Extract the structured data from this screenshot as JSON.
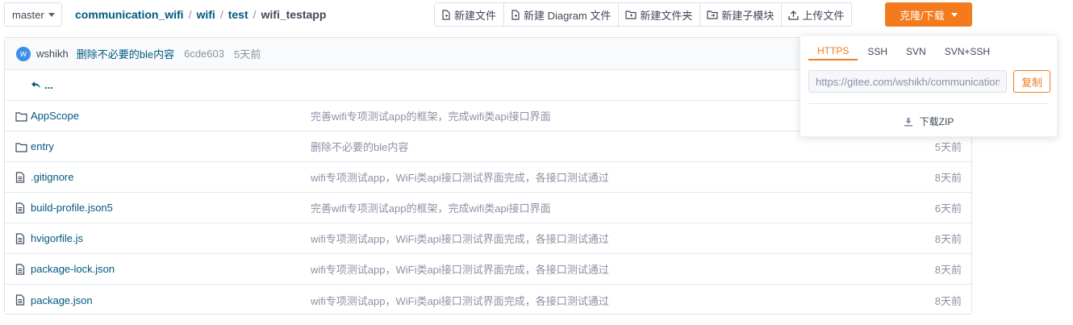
{
  "branch": {
    "label": "master"
  },
  "breadcrumb": {
    "repo": "communication_wifi",
    "dir1": "wifi",
    "dir2": "test",
    "current": "wifi_testapp",
    "sep": "/"
  },
  "toolbar": {
    "new_file": "新建文件",
    "new_diagram": "新建 Diagram 文件",
    "new_folder": "新建文件夹",
    "new_submodule": "新建子模块",
    "upload": "上传文件",
    "clone": "克隆/下载"
  },
  "commit": {
    "avatar_letter": "w",
    "author": "wshikh",
    "message": "删除不必要的ble内容",
    "sha": "6cde603",
    "time": "5天前"
  },
  "back": {
    "label": "..."
  },
  "files": [
    {
      "type": "folder",
      "name": "AppScope",
      "message": "完善wifi专项测试app的框架，完成wifi类api接口界面",
      "time": ""
    },
    {
      "type": "folder",
      "name": "entry",
      "message": "删除不必要的ble内容",
      "time": "5天前"
    },
    {
      "type": "file",
      "name": ".gitignore",
      "message": "wifi专项测试app，WiFi类api接口测试界面完成，各接口测试通过",
      "time": "8天前"
    },
    {
      "type": "file",
      "name": "build-profile.json5",
      "message": "完善wifi专项测试app的框架，完成wifi类api接口界面",
      "time": "6天前"
    },
    {
      "type": "file",
      "name": "hvigorfile.js",
      "message": "wifi专项测试app，WiFi类api接口测试界面完成，各接口测试通过",
      "time": "8天前"
    },
    {
      "type": "file",
      "name": "package-lock.json",
      "message": "wifi专项测试app，WiFi类api接口测试界面完成，各接口测试通过",
      "time": "8天前"
    },
    {
      "type": "file",
      "name": "package.json",
      "message": "wifi专项测试app，WiFi类api接口测试界面完成，各接口测试通过",
      "time": "8天前"
    }
  ],
  "clone_dropdown": {
    "tabs": [
      "HTTPS",
      "SSH",
      "SVN",
      "SVN+SSH"
    ],
    "active_tab": "HTTPS",
    "url": "https://gitee.com/wshikh/communication_wifi.git",
    "copy_label": "复制",
    "zip_label": "下载ZIP"
  },
  "colors": {
    "accent": "#f37b1d",
    "link": "#005980",
    "muted": "#8c92a4"
  }
}
